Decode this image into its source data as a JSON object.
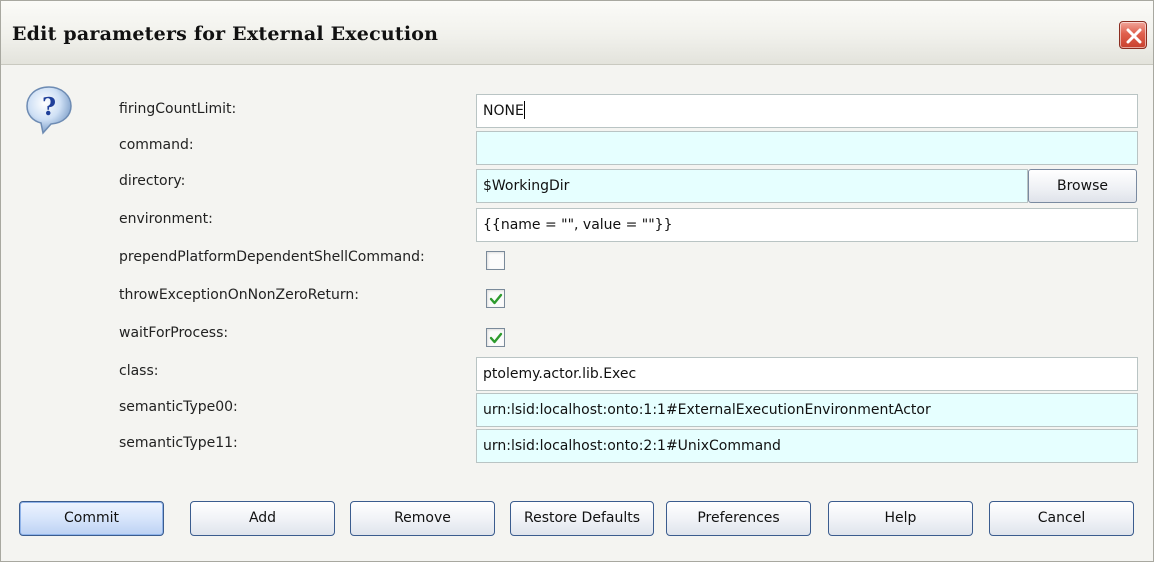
{
  "window": {
    "title": "Edit parameters for External Execution"
  },
  "icons": {
    "help": "question-mark-icon",
    "close": "close-x-icon",
    "check": "checkmark-icon"
  },
  "params": {
    "firingCountLimit": {
      "label": "firingCountLimit:",
      "value": "NONE"
    },
    "command": {
      "label": "command:",
      "value": ""
    },
    "directory": {
      "label": "directory:",
      "value": "$WorkingDir",
      "browse_label": "Browse"
    },
    "environment": {
      "label": "environment:",
      "value": "{{name = \"\", value = \"\"}}"
    },
    "prependPlatformDependentShellCommand": {
      "label": "prependPlatformDependentShellCommand:",
      "checked": false
    },
    "throwExceptionOnNonZeroReturn": {
      "label": "throwExceptionOnNonZeroReturn:",
      "checked": true
    },
    "waitForProcess": {
      "label": "waitForProcess:",
      "checked": true
    },
    "class": {
      "label": "class:",
      "value": "ptolemy.actor.lib.Exec"
    },
    "semanticType00": {
      "label": "semanticType00:",
      "value": "urn:lsid:localhost:onto:1:1#ExternalExecutionEnvironmentActor"
    },
    "semanticType11": {
      "label": "semanticType11:",
      "value": "urn:lsid:localhost:onto:2:1#UnixCommand"
    }
  },
  "buttons": {
    "commit": "Commit",
    "add": "Add",
    "remove": "Remove",
    "restore_defaults": "Restore Defaults",
    "preferences": "Preferences",
    "help": "Help",
    "cancel": "Cancel"
  },
  "colors": {
    "editable_field_bg": "#e6ffff",
    "active_field_bg": "#ffffff",
    "close_button": "#d9533f",
    "check_green": "#2e9b2e"
  }
}
